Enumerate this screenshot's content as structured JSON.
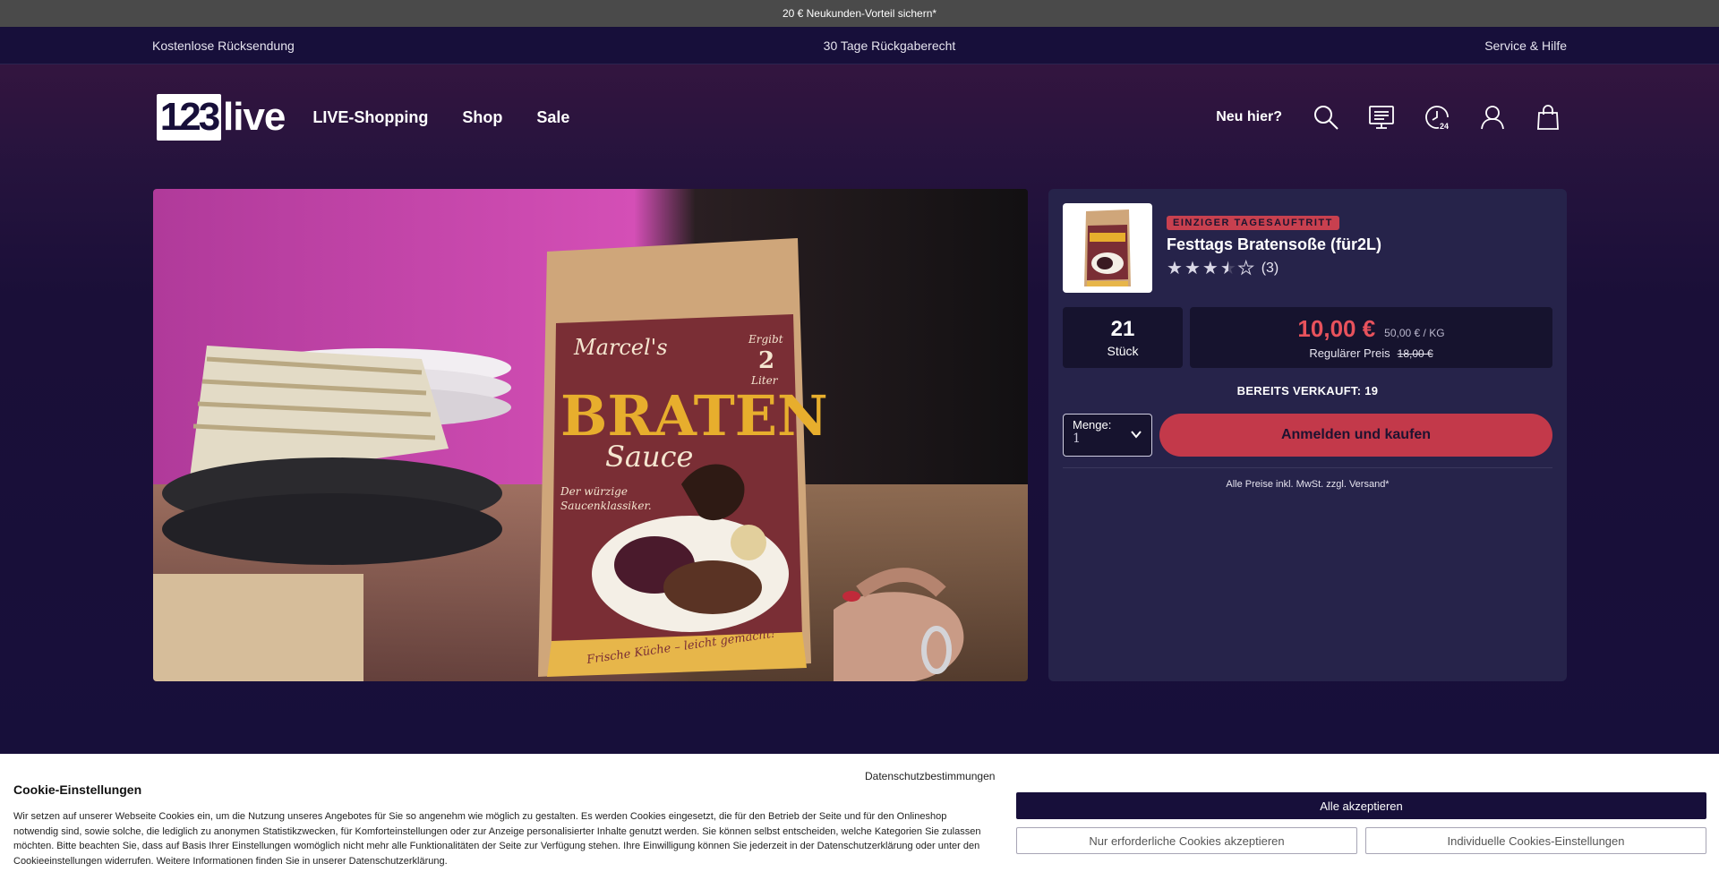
{
  "promo": {
    "text": "20 € Neukunden-Vorteil sichern*"
  },
  "info_bar": {
    "left": "Kostenlose Rücksendung",
    "center": "30 Tage Rückgaberecht",
    "right": "Service & Hilfe"
  },
  "header": {
    "logo_box": "123",
    "logo_text": "live",
    "nav": [
      "LIVE-Shopping",
      "Shop",
      "Sale"
    ],
    "new_here": "Neu hier?",
    "icons": [
      "search-icon",
      "tv-program-icon",
      "clock-24-icon",
      "account-icon",
      "cart-icon"
    ]
  },
  "product": {
    "badge": "EINZIGER TAGESAUFTRITT",
    "title": "Festtags Bratensoße (für2L)",
    "rating_value": 3.5,
    "rating_max": 5,
    "rating_count": "(3)",
    "stock_number": "21",
    "stock_unit": "Stück",
    "price": "10,00 €",
    "unit_price": "50,00 € / KG",
    "regular_label": "Regulärer Preis",
    "regular_price": "18,00 €",
    "sold": "BEREITS VERKAUFT: 19",
    "qty_label": "Menge:",
    "qty_value": "1",
    "buy_button": "Anmelden und kaufen",
    "vat_note": "Alle Preise inkl. MwSt. zzgl. Versand*"
  },
  "video": {
    "package_brand": "Marcel's",
    "package_badge_top": "Ergibt",
    "package_badge_big": "2",
    "package_badge_bottom": "Liter",
    "package_title": "BRATEN",
    "package_subtitle": "Sauce",
    "package_tagline_1": "Der würzige",
    "package_tagline_2": "Saucenklassiker.",
    "package_footer": "Frische Küche – leicht gemacht!"
  },
  "cookie": {
    "title": "Cookie-Einstellungen",
    "text": "Wir setzen auf unserer Webseite Cookies ein, um die Nutzung unseres Angebotes für Sie so angenehm wie möglich zu gestalten. Es werden Cookies eingesetzt, die für den Betrieb der Seite und für den Onlineshop notwendig sind, sowie solche, die lediglich zu anonymen Statistikzwecken, für Komforteinstellungen oder zur Anzeige personalisierter Inhalte genutzt werden. Sie können selbst entscheiden, welche Kategorien Sie zulassen möchten. Bitte beachten Sie, dass auf Basis Ihrer Einstellungen womöglich nicht mehr alle Funktionalitäten der Seite zur Verfügung stehen. Ihre Einwilligung können Sie jederzeit in der Datenschutzerklärung oder unter den Cookieeinstellungen widerrufen. Weitere Informationen finden Sie in unserer Datenschutzerklärung.",
    "privacy_link": "Datenschutzbestimmungen",
    "accept_all": "Alle akzeptieren",
    "only_required": "Nur erforderliche Cookies akzeptieren",
    "individual": "Individuelle Cookies-Einstellungen"
  },
  "colors": {
    "background": "#170f3a",
    "panel": "#26234a",
    "accent_red": "#c3394a",
    "price_red": "#e8525c"
  }
}
